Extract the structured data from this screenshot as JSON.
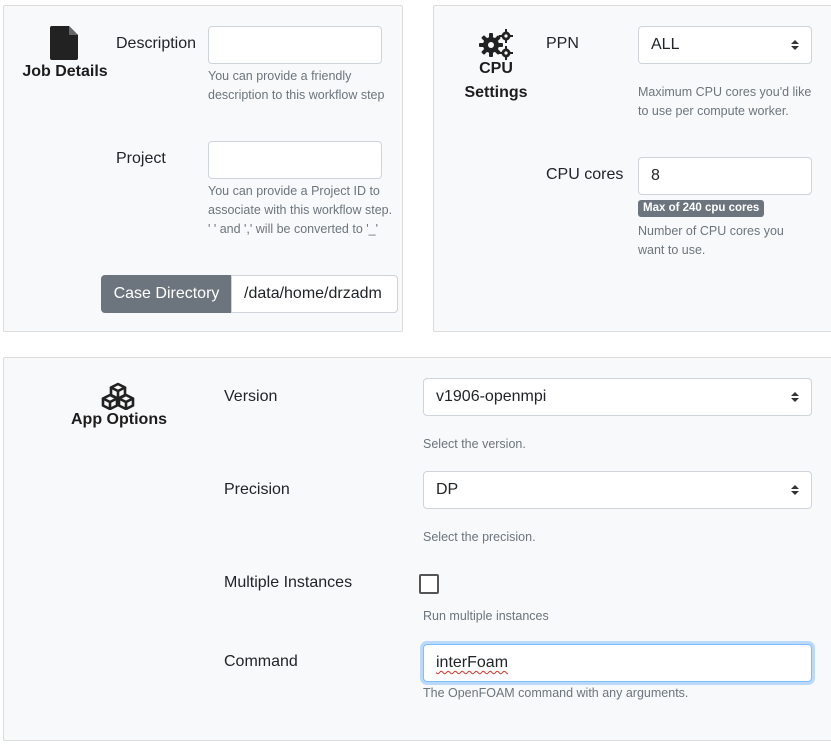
{
  "job_details": {
    "title": "Job Details",
    "icon": "file-icon",
    "description": {
      "label": "Description",
      "value": "",
      "help": "You can provide a friendly description to this workflow step"
    },
    "project": {
      "label": "Project",
      "value": "",
      "help": "You can provide a Project ID to associate with this workflow step. ' ' and ',' will be converted to '_'"
    },
    "case_directory": {
      "label": "Case Directory",
      "value": "/data/home/drzadm"
    }
  },
  "cpu_settings": {
    "title_line1": "CPU",
    "title_line2": "Settings",
    "icon": "gears-icon",
    "ppn": {
      "label": "PPN",
      "selected": "ALL",
      "help": "Maximum CPU cores you'd like to use per compute worker."
    },
    "cpu_cores": {
      "label": "CPU cores",
      "value": "8",
      "badge": "Max of 240 cpu cores",
      "help": "Number of CPU cores you want to use."
    }
  },
  "app_options": {
    "title": "App Options",
    "icon": "cubes-icon",
    "version": {
      "label": "Version",
      "selected": "v1906-openmpi",
      "help": "Select the version."
    },
    "precision": {
      "label": "Precision",
      "selected": "DP",
      "help": "Select the precision."
    },
    "multiple_instances": {
      "label": "Multiple Instances",
      "checked": false,
      "help": "Run multiple instances"
    },
    "command": {
      "label": "Command",
      "value": "interFoam",
      "help": "The OpenFOAM command with any arguments."
    }
  }
}
